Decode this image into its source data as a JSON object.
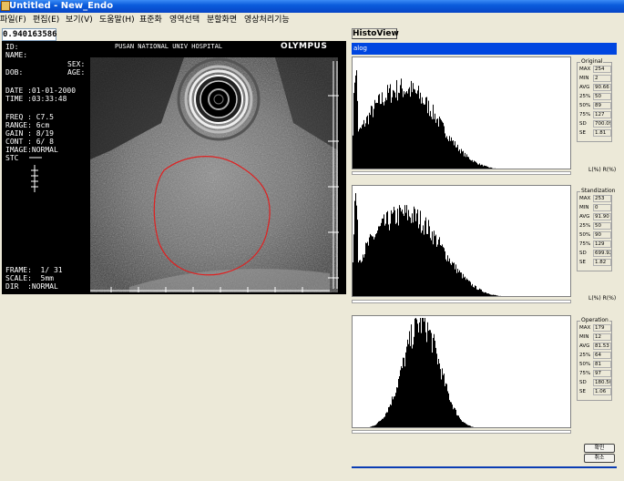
{
  "window": {
    "title": "Untitled - New_Endo"
  },
  "menu": [
    {
      "label": "파일(F)"
    },
    {
      "label": "편집(E)"
    },
    {
      "label": "보기(V)"
    },
    {
      "label": "도움말(H)"
    },
    {
      "label": "표준화"
    },
    {
      "label": "영역선택"
    },
    {
      "label": "분할화면"
    },
    {
      "label": "영상처리기능"
    }
  ],
  "value_readout": "0.940163586",
  "ultrasound": {
    "id_label": "ID:",
    "name_label": "NAME:",
    "hospital": "PUSAN NATIONAL UNIV HOSPITAL",
    "brand": "OLYMPUS",
    "sex_label": "SEX:",
    "dob_label": "DOB:",
    "age_label": "AGE:",
    "date": "DATE :01-01-2000",
    "time": "TIME :03:33:48",
    "freq": "FREQ : C7.5",
    "range": "RANGE: 6cm",
    "gain": "GAIN : 8/19",
    "cont": "CONT : 6/ 8",
    "image": "IMAGE:NORMAL",
    "stc": "STC",
    "frame": "FRAME:  1/ 31",
    "scale": "SCALE:  5mm",
    "dir": "DIR  :NORMAL",
    "roi_color": "#E02020"
  },
  "histo_view": {
    "button_label": "HistoView",
    "header_label": "alog",
    "header_color": "#0046E0",
    "panels": [
      {
        "title": "Original",
        "stats": [
          {
            "label": "MAX",
            "value": "254"
          },
          {
            "label": "MIN",
            "value": "2"
          },
          {
            "label": "AVG",
            "value": "90.66"
          },
          {
            "label": "25%",
            "value": "50"
          },
          {
            "label": "50%",
            "value": "89"
          },
          {
            "label": "75%",
            "value": "127"
          },
          {
            "label": "SD",
            "value": "700.09"
          },
          {
            "label": "SE",
            "value": "1.81"
          }
        ],
        "lr": "L(%)  R(%)",
        "shape": "original"
      },
      {
        "title": "Standization",
        "stats": [
          {
            "label": "MAX",
            "value": "253"
          },
          {
            "label": "MIN",
            "value": "0"
          },
          {
            "label": "AVG",
            "value": "91.90"
          },
          {
            "label": "25%",
            "value": "50"
          },
          {
            "label": "50%",
            "value": "90"
          },
          {
            "label": "75%",
            "value": "129"
          },
          {
            "label": "SD",
            "value": "699.92"
          },
          {
            "label": "SE",
            "value": "1.82"
          }
        ],
        "lr": "L(%)  R(%)",
        "shape": "standard"
      },
      {
        "title": "Operation",
        "stats": [
          {
            "label": "MAX",
            "value": "179"
          },
          {
            "label": "MIN",
            "value": "12"
          },
          {
            "label": "AVG",
            "value": "81.53"
          },
          {
            "label": "25%",
            "value": "64"
          },
          {
            "label": "50%",
            "value": "81"
          },
          {
            "label": "75%",
            "value": "97"
          },
          {
            "label": "SD",
            "value": "180.50"
          },
          {
            "label": "SE",
            "value": "1.06"
          }
        ],
        "lr": "",
        "shape": "operation"
      }
    ]
  },
  "buttons": {
    "ok": "확인",
    "cancel": "취소"
  }
}
